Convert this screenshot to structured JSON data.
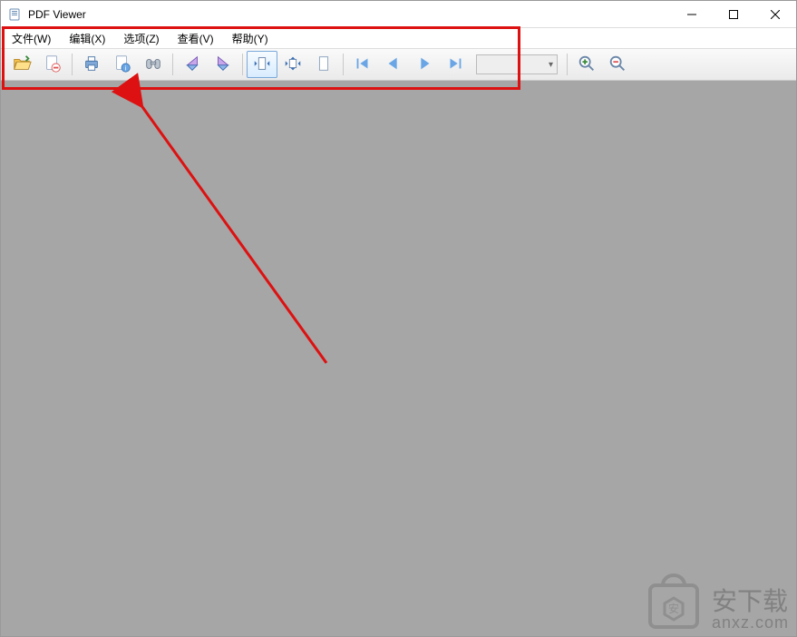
{
  "title": "PDF Viewer",
  "menu": {
    "file": "文件(W)",
    "edit": "编辑(X)",
    "options": "选项(Z)",
    "view": "查看(V)",
    "help": "帮助(Y)"
  },
  "toolbar": {
    "page_select": ""
  },
  "watermark": {
    "cn": "安下载",
    "url": "anxz.com"
  }
}
